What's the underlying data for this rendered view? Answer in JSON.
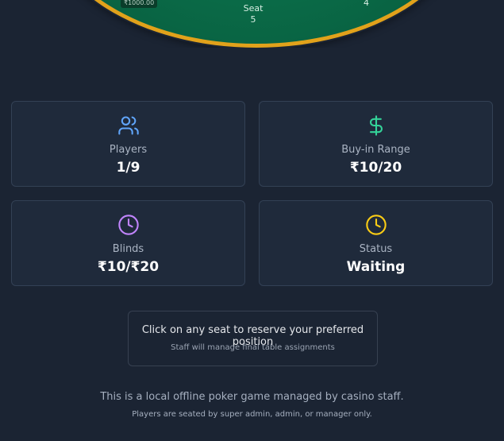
{
  "table": {
    "seat_chip_amount": "₹1000.00",
    "seat_label": "Seat",
    "seat_number": "5",
    "right_seat_number": "4",
    "felt_color": "#0a6a47",
    "rail_color": "#e1a21b"
  },
  "stats": [
    {
      "label": "Players",
      "value": "1/9",
      "icon": "users-icon",
      "icon_color": "#60a5fa"
    },
    {
      "label": "Buy-in Range",
      "value": "₹10/20",
      "icon": "dollar-icon",
      "icon_color": "#34d399"
    },
    {
      "label": "Blinds",
      "value": "₹10/₹20",
      "icon": "clock-icon",
      "icon_color": "#c084fc"
    },
    {
      "label": "Status",
      "value": "Waiting",
      "icon": "clock-icon",
      "icon_color": "#facc15"
    }
  ],
  "info": {
    "title": "Click on any seat to reserve your preferred position",
    "subtitle": "Staff will manage final table assignments"
  },
  "footer": {
    "line1": "This is a local offline poker game managed by casino staff.",
    "line2": "Players are seated by super admin, admin, or manager only."
  }
}
